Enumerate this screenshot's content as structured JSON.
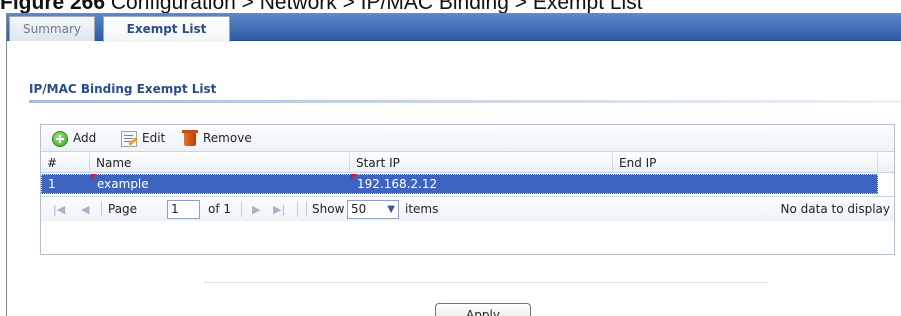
{
  "caption": {
    "figure_label": "Figure 266",
    "text": "Configuration > Network > IP/MAC Binding > Exempt List"
  },
  "tabs": [
    {
      "label": "Summary",
      "active": false
    },
    {
      "label": "Exempt List",
      "active": true
    }
  ],
  "section": {
    "title": "IP/MAC Binding Exempt List"
  },
  "toolbar": {
    "add_label": "Add",
    "edit_label": "Edit",
    "remove_label": "Remove"
  },
  "table": {
    "columns": [
      "#",
      "Name",
      "Start IP",
      "End IP"
    ],
    "rows": [
      {
        "index": "1",
        "name": "example",
        "start_ip": "192.168.2.12",
        "end_ip": ""
      }
    ]
  },
  "pager": {
    "page_label": "Page",
    "page_value": "1",
    "of_label": "of 1",
    "show_label": "Show",
    "show_value": "50",
    "items_label": "items",
    "status": "No data to display"
  },
  "actions": {
    "apply_label": "Apply"
  },
  "colors": {
    "tab_bar": "#2f5aa6",
    "selected_row": "#3e64c2",
    "title_blue": "#2b4d86"
  }
}
